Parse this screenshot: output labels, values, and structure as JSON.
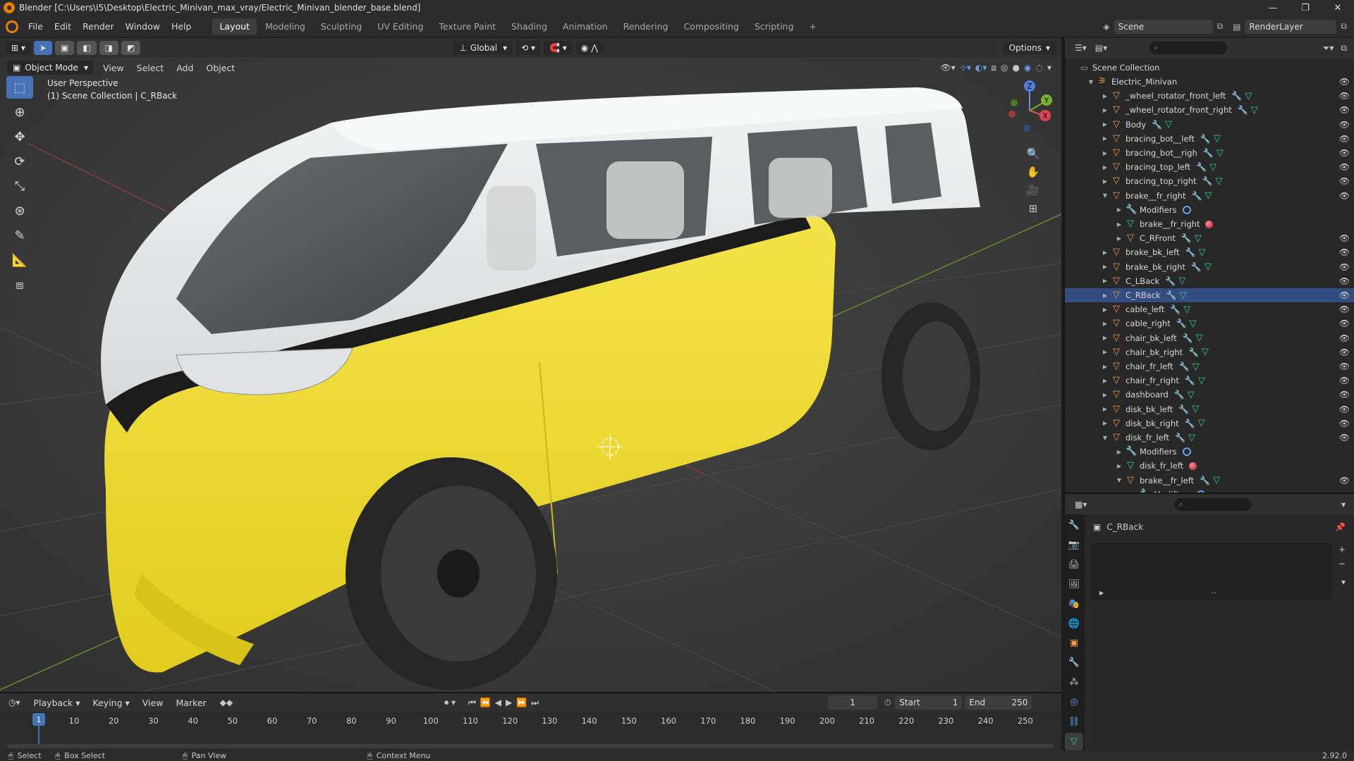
{
  "window": {
    "title": "Blender [C:\\Users\\I5\\Desktop\\Electric_Minivan_max_vray/Electric_Minivan_blender_base.blend]",
    "minimize": "—",
    "maximize": "❐",
    "close": "✕"
  },
  "menu": [
    "File",
    "Edit",
    "Render",
    "Window",
    "Help"
  ],
  "workspaces": [
    "Layout",
    "Modeling",
    "Sculpting",
    "UV Editing",
    "Texture Paint",
    "Shading",
    "Animation",
    "Rendering",
    "Compositing",
    "Scripting",
    "+"
  ],
  "scene": {
    "name": "Scene",
    "render_layer": "RenderLayer"
  },
  "tool_header": {
    "orientation": "Global",
    "options": "Options"
  },
  "viewport_header": {
    "mode": "Object Mode",
    "menus": [
      "View",
      "Select",
      "Add",
      "Object"
    ]
  },
  "viewport_info": {
    "line1": "User Perspective",
    "line2": "(1) Scene Collection | C_RBack"
  },
  "gizmo": {
    "x": "X",
    "y": "Y",
    "z": "Z"
  },
  "outliner": {
    "root": "Scene Collection",
    "rows": [
      {
        "label": "Electric_Minivan",
        "indent": 1,
        "icon": "collection",
        "open": true
      },
      {
        "label": "_wheel_rotator_front_left",
        "indent": 2,
        "icon": "object",
        "open": false
      },
      {
        "label": "_wheel_rotator_front_right",
        "indent": 2,
        "icon": "object",
        "open": false
      },
      {
        "label": "Body",
        "indent": 2,
        "icon": "object",
        "open": false
      },
      {
        "label": "bracing_bot__left",
        "indent": 2,
        "icon": "object",
        "open": false
      },
      {
        "label": "bracing_bot__righ",
        "indent": 2,
        "icon": "object",
        "open": false
      },
      {
        "label": "bracing_top_left",
        "indent": 2,
        "icon": "object",
        "open": false
      },
      {
        "label": "bracing_top_right",
        "indent": 2,
        "icon": "object",
        "open": false
      },
      {
        "label": "brake__fr_right",
        "indent": 2,
        "icon": "object",
        "open": true
      },
      {
        "label": "Modifiers",
        "indent": 3,
        "icon": "modifier",
        "open": false
      },
      {
        "label": "brake__fr_right",
        "indent": 3,
        "icon": "mesh",
        "open": false
      },
      {
        "label": "C_RFront",
        "indent": 3,
        "icon": "object",
        "open": false
      },
      {
        "label": "brake_bk_left",
        "indent": 2,
        "icon": "object",
        "open": false
      },
      {
        "label": "brake_bk_right",
        "indent": 2,
        "icon": "object",
        "open": false
      },
      {
        "label": "C_LBack",
        "indent": 2,
        "icon": "object",
        "open": false
      },
      {
        "label": "C_RBack",
        "indent": 2,
        "icon": "object",
        "open": false,
        "selected": true
      },
      {
        "label": "cable_left",
        "indent": 2,
        "icon": "object",
        "open": false
      },
      {
        "label": "cable_right",
        "indent": 2,
        "icon": "object",
        "open": false
      },
      {
        "label": "chair_bk_left",
        "indent": 2,
        "icon": "object",
        "open": false
      },
      {
        "label": "chair_bk_right",
        "indent": 2,
        "icon": "object",
        "open": false
      },
      {
        "label": "chair_fr_left",
        "indent": 2,
        "icon": "object",
        "open": false
      },
      {
        "label": "chair_fr_right",
        "indent": 2,
        "icon": "object",
        "open": false
      },
      {
        "label": "dashboard",
        "indent": 2,
        "icon": "object",
        "open": false
      },
      {
        "label": "disk_bk_left",
        "indent": 2,
        "icon": "object",
        "open": false
      },
      {
        "label": "disk_bk_right",
        "indent": 2,
        "icon": "object",
        "open": false
      },
      {
        "label": "disk_fr_left",
        "indent": 2,
        "icon": "object",
        "open": true
      },
      {
        "label": "Modifiers",
        "indent": 3,
        "icon": "modifier",
        "open": false
      },
      {
        "label": "disk_fr_left",
        "indent": 3,
        "icon": "mesh",
        "open": false
      },
      {
        "label": "brake__fr_left",
        "indent": 3,
        "icon": "object",
        "open": true
      },
      {
        "label": "Modifiers",
        "indent": 4,
        "icon": "modifier",
        "open": false
      }
    ]
  },
  "properties": {
    "object_name": "C_RBack"
  },
  "timeline": {
    "menus": [
      "Playback",
      "Keying",
      "View",
      "Marker"
    ],
    "current_frame": "1",
    "start_label": "Start",
    "start": "1",
    "end_label": "End",
    "end": "250",
    "ticks": [
      "10",
      "20",
      "30",
      "40",
      "50",
      "60",
      "70",
      "80",
      "90",
      "100",
      "110",
      "120",
      "130",
      "140",
      "150",
      "160",
      "170",
      "180",
      "190",
      "200",
      "210",
      "220",
      "230",
      "240",
      "250"
    ],
    "current_marker": "1"
  },
  "status": {
    "select": "Select",
    "box_select": "Box Select",
    "pan": "Pan View",
    "context": "Context Menu",
    "version": "2.92.0"
  }
}
